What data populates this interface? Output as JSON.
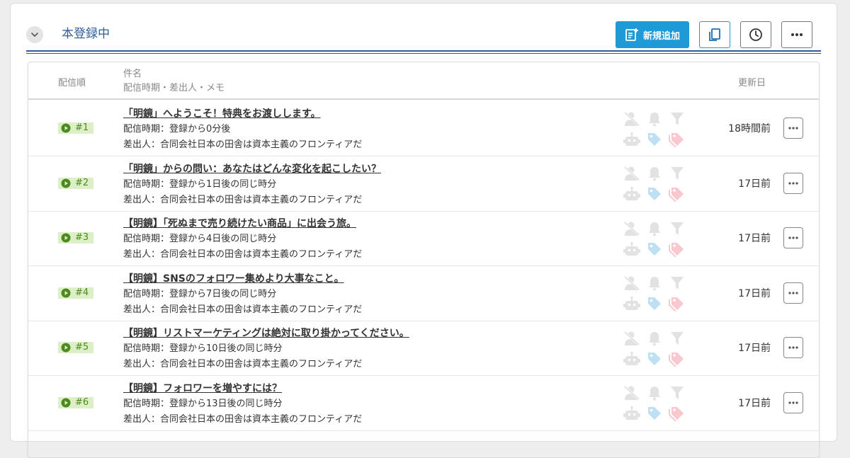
{
  "section": {
    "title": "本登録中"
  },
  "toolbar": {
    "add_label": "新規追加"
  },
  "table": {
    "headers": {
      "order": "配信順",
      "subject_line1": "件名",
      "subject_line2": "配信時期・差出人・メモ",
      "updated": "更新日"
    },
    "rows": [
      {
        "number": "#1",
        "subject": "「明鏡」へようこそ！特典をお渡しします。",
        "timing": "配信時期：登録から0分後",
        "sender": "差出人：合同会社日本の田舎は資本主義のフロンティアだ",
        "updated": "18時間前"
      },
      {
        "number": "#2",
        "subject": "「明鏡」からの問い：あなたはどんな変化を起こしたい？",
        "timing": "配信時期：登録から1日後の同じ時分",
        "sender": "差出人：合同会社日本の田舎は資本主義のフロンティアだ",
        "updated": "17日前"
      },
      {
        "number": "#3",
        "subject": "【明鏡】「死ぬまで売り続けたい商品」に出会う旅。",
        "timing": "配信時期：登録から4日後の同じ時分",
        "sender": "差出人：合同会社日本の田舎は資本主義のフロンティアだ",
        "updated": "17日前"
      },
      {
        "number": "#4",
        "subject": "【明鏡】SNSのフォロワー集めより大事なこと。",
        "timing": "配信時期：登録から7日後の同じ時分",
        "sender": "差出人：合同会社日本の田舎は資本主義のフロンティアだ",
        "updated": "17日前"
      },
      {
        "number": "#5",
        "subject": "【明鏡】リストマーケティングは絶対に取り掛かってください。",
        "timing": "配信時期：登録から10日後の同じ時分",
        "sender": "差出人：合同会社日本の田舎は資本主義のフロンティアだ",
        "updated": "17日前"
      },
      {
        "number": "#6",
        "subject": "【明鏡】フォロワーを増やすには？",
        "timing": "配信時期：登録から13日後の同じ時分",
        "sender": "差出人：合同会社日本の田舎は資本主義のフロンティアだ",
        "updated": "17日前"
      }
    ]
  },
  "icons": [
    "chevron-down-icon",
    "add-note-icon",
    "copy-icon",
    "clock-icon",
    "more-icon",
    "play-icon",
    "user-off-icon",
    "bell-icon",
    "filter-icon",
    "robot-icon",
    "tag-icon"
  ],
  "colors": {
    "accent": "#1e9bd7",
    "title": "#2f5d9a",
    "badge_bg": "#ddefc7",
    "badge_fg": "#4c8a1f",
    "tag_blue": "#bfe0f3",
    "tag_red": "#f7c9cf"
  }
}
